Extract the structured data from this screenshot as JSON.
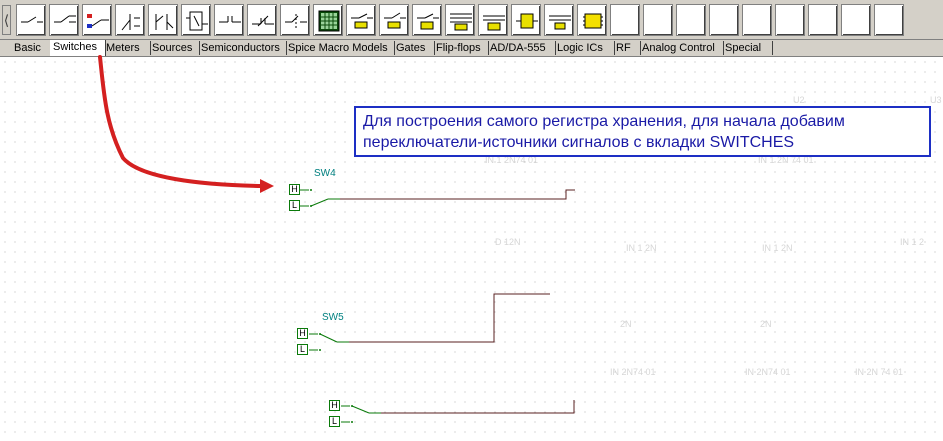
{
  "toolbar": {
    "scroll_left_glyph": "⟨",
    "buttons": [
      {
        "name": "switch-spst-icon"
      },
      {
        "name": "switch-pushbutton-icon"
      },
      {
        "name": "switch-input-icon"
      },
      {
        "name": "switch-spdt-icon"
      },
      {
        "name": "switch-dip-icon"
      },
      {
        "name": "switch-relay-icon"
      },
      {
        "name": "switch-contact-icon"
      },
      {
        "name": "switch-nc-contact-icon"
      },
      {
        "name": "switch-toggle-icon"
      },
      {
        "name": "keypad-icon"
      },
      {
        "name": "switch-tc-icon"
      },
      {
        "name": "switch-to-icon"
      },
      {
        "name": "switch-delay-icon"
      },
      {
        "name": "switch-multi-icon"
      },
      {
        "name": "switch-ladder-icon"
      },
      {
        "name": "switch-coil-icon"
      },
      {
        "name": "switch-analog-icon"
      },
      {
        "name": "chip-icon"
      },
      {
        "name": "empty-slot-icon"
      },
      {
        "name": "empty-slot-icon"
      },
      {
        "name": "empty-slot-icon"
      },
      {
        "name": "empty-slot-icon"
      },
      {
        "name": "empty-slot-icon"
      },
      {
        "name": "empty-slot-icon"
      },
      {
        "name": "empty-slot-icon"
      },
      {
        "name": "empty-slot-icon"
      },
      {
        "name": "empty-slot-icon"
      }
    ]
  },
  "tabs": [
    "Basic",
    "Switches",
    "Meters",
    "Sources",
    "Semiconductors",
    "Spice Macro Models",
    "Gates",
    "Flip-flops",
    "AD/DA-555",
    "Logic ICs",
    "RF",
    "Analog Control",
    "Special"
  ],
  "active_tab": "Switches",
  "callout": {
    "line1": "Для построения самого регистра хранения, для начала добавим",
    "line2": "переключатели-источники сигналов с вкладки SWITCHES"
  },
  "switches": [
    {
      "label": "SW4",
      "h": "H",
      "l": "L"
    },
    {
      "label": "SW5",
      "h": "H",
      "l": "L"
    },
    {
      "label": "",
      "h": "H",
      "l": "L"
    }
  ],
  "colors": {
    "toolbar_bg": "#d4d0c8",
    "arrow": "#d42020",
    "wire": "#5a2020",
    "callout_border": "#1d2fc4",
    "callout_text": "#1a1aa6",
    "switch_label": "#008080",
    "switch_green": "#0a7a0a"
  }
}
